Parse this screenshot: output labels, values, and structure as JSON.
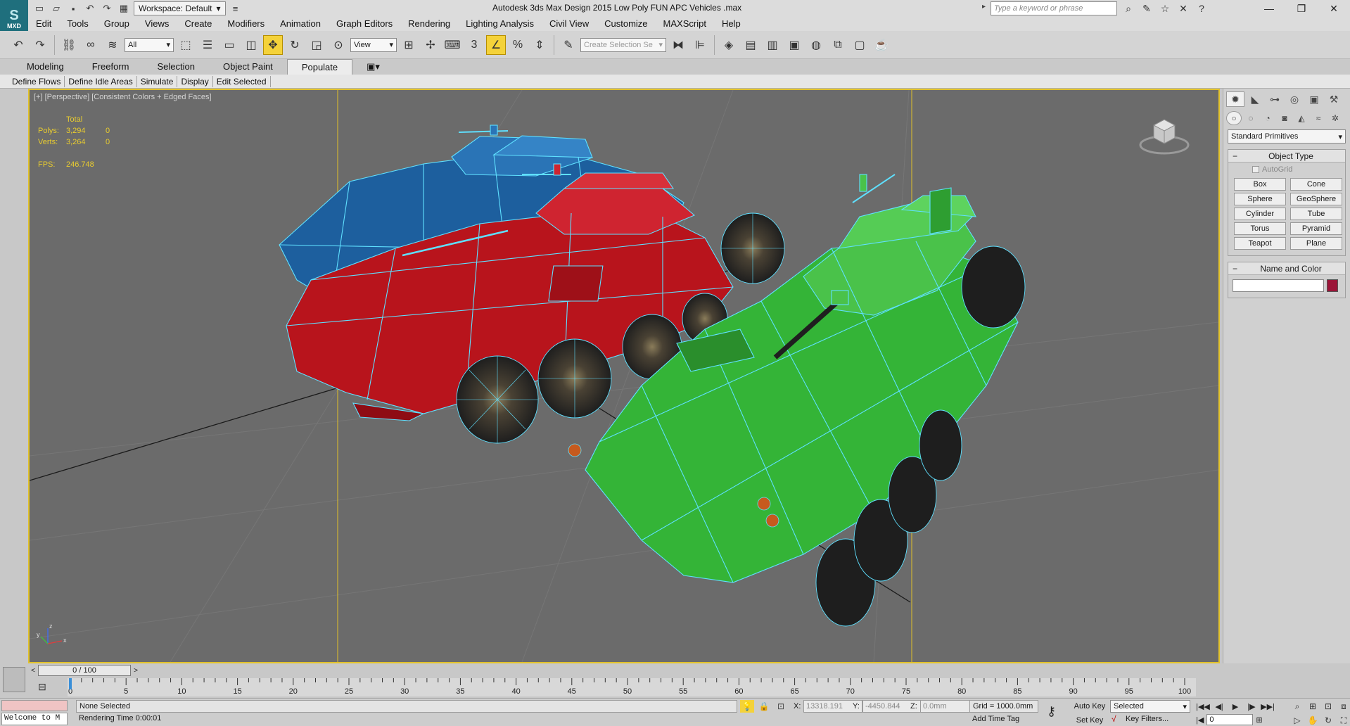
{
  "app": {
    "logo_label": "MXD",
    "title": "Autodesk 3ds Max Design 2015     Low Poly FUN APC Vehicles .max",
    "workspace": "Workspace: Default",
    "search_placeholder": "Type a keyword or phrase"
  },
  "menu": [
    "Edit",
    "Tools",
    "Group",
    "Views",
    "Create",
    "Modifiers",
    "Animation",
    "Graph Editors",
    "Rendering",
    "Lighting Analysis",
    "Civil View",
    "Customize",
    "MAXScript",
    "Help"
  ],
  "toolbar": {
    "selection_filter": "All",
    "ref_coord": "View",
    "snap_label": "3",
    "named_selection_placeholder": "Create Selection Se"
  },
  "ribbon": {
    "tabs": [
      "Modeling",
      "Freeform",
      "Selection",
      "Object Paint",
      "Populate"
    ],
    "active_tab": "Populate",
    "sub_items": [
      "Define Flows",
      "Define Idle Areas",
      "Simulate",
      "Display",
      "Edit Selected"
    ]
  },
  "viewport": {
    "label": "[+] [Perspective] [Consistent Colors + Edged Faces]",
    "stats": {
      "header": "Total",
      "polys_label": "Polys:",
      "polys_total": "3,294",
      "polys_sel": "0",
      "verts_label": "Verts:",
      "verts_total": "3,264",
      "verts_sel": "0",
      "fps_label": "FPS:",
      "fps_value": "246.748"
    },
    "axis_labels": {
      "z": "z",
      "x": "x",
      "y": "y"
    },
    "colors": {
      "background": "#6b6b6b",
      "border": "#e2c22a",
      "wire": "#5fe0ff",
      "vehicle_blue": "#1d5f9e",
      "vehicle_red": "#b8141c",
      "vehicle_green": "#34b437",
      "wheel": "#2a2a2a"
    }
  },
  "command_panel": {
    "category": "Standard Primitives",
    "object_type_title": "Object Type",
    "autogrid_label": "AutoGrid",
    "primitives": [
      "Box",
      "Cone",
      "Sphere",
      "GeoSphere",
      "Cylinder",
      "Tube",
      "Torus",
      "Pyramid",
      "Teapot",
      "Plane"
    ],
    "name_color_title": "Name and Color",
    "swatch_color": "#9c1438"
  },
  "time": {
    "slider_label": "0 / 100",
    "ticks": [
      "0",
      "5",
      "10",
      "15",
      "20",
      "25",
      "30",
      "35",
      "40",
      "45",
      "50",
      "55",
      "60",
      "65",
      "70",
      "75",
      "80",
      "85",
      "90",
      "95",
      "100"
    ]
  },
  "status": {
    "listener": "Welcome to M",
    "message": "None Selected",
    "render_time": "Rendering Time  0:00:01",
    "x_label": "X:",
    "x_value": "13318.191",
    "y_label": "Y:",
    "y_value": "-4450.844",
    "z_label": "Z:",
    "z_value": "0.0mm",
    "grid": "Grid = 1000.0mm",
    "add_time_tag": "Add Time Tag",
    "auto_key": "Auto Key",
    "set_key": "Set Key",
    "key_mode": "Selected",
    "key_filters": "Key Filters...",
    "frame": "0"
  }
}
